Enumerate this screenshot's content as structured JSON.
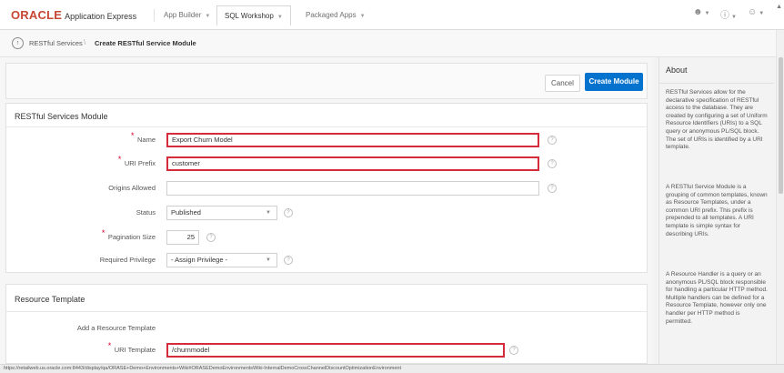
{
  "header": {
    "brand": "ORACLE",
    "product": "Application Express",
    "tabs": [
      {
        "label": "App Builder"
      },
      {
        "label": "SQL Workshop"
      },
      {
        "label": "Packaged Apps"
      }
    ],
    "icons": [
      "user-icon",
      "help-icon",
      "account-icon"
    ]
  },
  "breadcrumb": {
    "parent": "RESTful Services",
    "separator": "\\",
    "current": "Create RESTful Service Module"
  },
  "buttons": {
    "cancel": "Cancel",
    "create": "Create Module"
  },
  "module_region": {
    "title": "RESTful Services Module",
    "fields": {
      "name": {
        "label": "Name",
        "value": "Export Churn Model",
        "required": true
      },
      "uri_prefix": {
        "label": "URI Prefix",
        "value": "customer",
        "required": true
      },
      "origins_allowed": {
        "label": "Origins Allowed",
        "value": ""
      },
      "status": {
        "label": "Status",
        "value": "Published"
      },
      "pagination_size": {
        "label": "Pagination Size",
        "value": "25",
        "required": true
      },
      "required_privilege": {
        "label": "Required Privilege",
        "value": "- Assign Privilege -"
      }
    }
  },
  "resource_region": {
    "title": "Resource Template",
    "add_label": "Add a Resource Template",
    "uri_template": {
      "label": "URI Template",
      "value": "/churnmodel",
      "required": true
    }
  },
  "sidebar": {
    "title": "About",
    "paragraphs": [
      "RESTful Services allow for the declarative specification of RESTful access to the database. They are created by configuring a set of Uniform Resource Identifiers (URIs) to a SQL query or anonymous PL/SQL block. The set of URIs is identified by a URI template.",
      "A RESTful Service Module is a grouping of common templates, known as Resource Templates, under a common URI prefix. This prefix is prepended to all templates. A URI template is simple syntax for describing URIs.",
      "A Resource Handler is a query or an anonymous PL/SQL block responsible for handling a particular HTTP method. Multiple handlers can be defined for a Resource Template, however only one handler per HTTP method is permitted."
    ]
  },
  "status_url": "https://retailweb.us.oracle.com:8443/display/qa/ORASE+Demo+Environments+Wiki#ORASEDemoEnvironmentsWiki-InternalDemoCrossChannelDiscountOptimizationEnvironment",
  "colors": {
    "brand_red": "#c74634",
    "primary_button": "#0572ce",
    "highlight_border": "#d62b3a",
    "required_marker": "#e0002a"
  }
}
